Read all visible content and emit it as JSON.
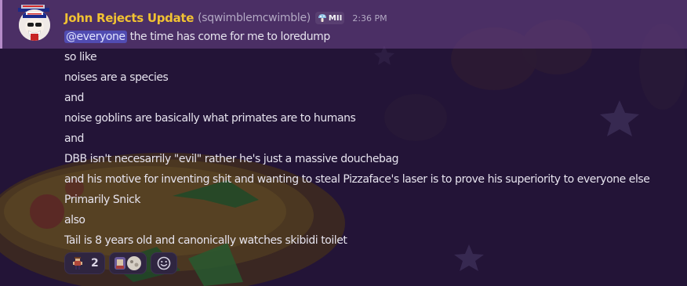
{
  "message": {
    "author": {
      "display_name": "John Rejects Update",
      "handle": "(sqwimblemcwimble)",
      "guild_tag": "MII",
      "name_color": "#f1c232"
    },
    "timestamp": "2:36 PM",
    "mention": "@everyone",
    "lines": [
      "the time has come for me to loredump",
      "so like",
      "noises are a species",
      "and",
      "noise goblins are basically what primates are to humans",
      "and",
      "DBB isn't necesarrily \"evil\" rather he's just a massive douchebag",
      "and his motive for inventing shit and wanting to steal Pizzaface's laser is to prove his superiority to everyone else",
      "Primarily Snick",
      "also",
      "Tail is 8 years old and canonically watches skibidi toilet"
    ]
  },
  "reactions": [
    {
      "emoji": "pixel-character-emoji",
      "count": "2"
    },
    {
      "emoji": "custom-emoji-pair"
    },
    {
      "emoji": "add-reaction-icon"
    }
  ],
  "theme": {
    "mention_bg": "#6d468c",
    "background": "#221336"
  }
}
